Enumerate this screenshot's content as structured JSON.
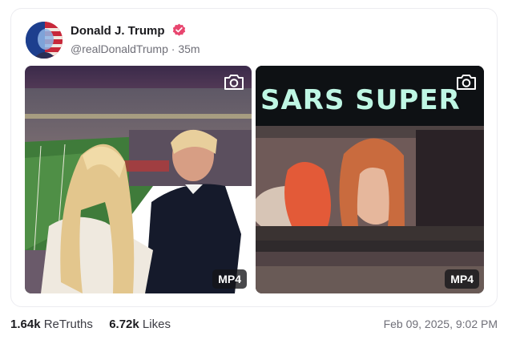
{
  "post": {
    "display_name": "Donald J. Trump",
    "handle": "@realDonaldTrump",
    "separator": "·",
    "age": "35m",
    "verified_icon": "verified-badge-icon",
    "avatar_icon": "profile-avatar"
  },
  "media": [
    {
      "badge": "MP4",
      "overlay_icon": "camera-icon"
    },
    {
      "badge": "MP4",
      "overlay_icon": "camera-icon",
      "scoreboard_text": "SARS SUPER"
    }
  ],
  "stats": {
    "retruths_count": "1.64k",
    "retruths_label": "ReTruths",
    "likes_count": "6.72k",
    "likes_label": "Likes"
  },
  "timestamp": "Feb 09, 2025, 9:02 PM",
  "colors": {
    "verified": "#e8466f",
    "muted_text": "#6f6f78",
    "scoreboard_text": "#bff7e4"
  }
}
